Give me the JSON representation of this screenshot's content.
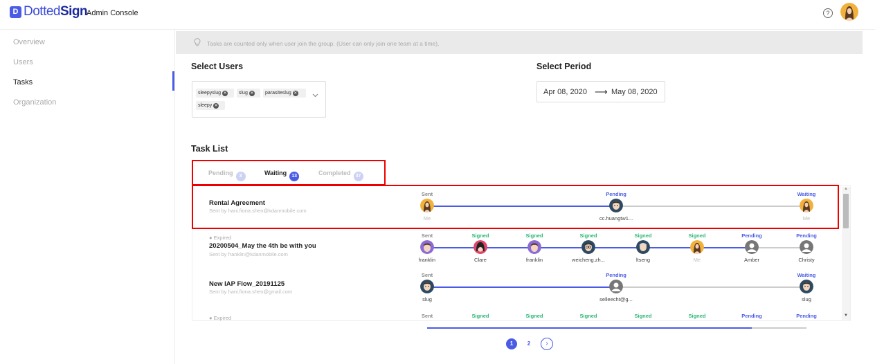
{
  "header": {
    "logo_mark": "D",
    "logo_text_a": "Dotted",
    "logo_text_b": "Sign",
    "admin_label": "Admin Console",
    "help_glyph": "?",
    "help_icon": "help-icon",
    "avatar_icon": "user-avatar-icon"
  },
  "sidebar": {
    "items": [
      {
        "label": "Overview"
      },
      {
        "label": "Users"
      },
      {
        "label": "Tasks",
        "active": true
      },
      {
        "label": "Organization"
      }
    ]
  },
  "notice": {
    "icon": "lightbulb-icon",
    "text": "Tasks are counted only when user join the group. (User can only join one team at a time)."
  },
  "select_users": {
    "title": "Select Users",
    "tags": [
      "sleepyslug",
      "slug",
      "parasiteslug",
      "sleepy"
    ],
    "remove_glyph": "✕"
  },
  "select_period": {
    "title": "Select Period",
    "start": "Apr 08, 2020",
    "arrow": "⟶",
    "end": "May 08, 2020"
  },
  "task_list": {
    "title": "Task List",
    "tabs": [
      {
        "label": "Pending",
        "count": "3"
      },
      {
        "label": "Waiting",
        "count": "13",
        "active": true
      },
      {
        "label": "Completed",
        "count": "37"
      }
    ],
    "tasks": [
      {
        "title": "Rental Agreement",
        "sender": "Sent by hani.fiona.shen@kdanmobile.com",
        "steps": [
          {
            "status": "Sent",
            "name": "Me"
          },
          {
            "status": "Pending",
            "name": "cc.huangtw1..."
          },
          {
            "status": "Waiting",
            "name": "Me"
          }
        ]
      },
      {
        "expired": "Expired",
        "title": "20200504_May the 4th be with you",
        "sender": "Sent by franklin@kdanmobile.com",
        "steps": [
          {
            "status": "Sent",
            "name": "franklin"
          },
          {
            "status": "Signed",
            "name": "Clare"
          },
          {
            "status": "Signed",
            "name": "franklin"
          },
          {
            "status": "Signed",
            "name": "weicheng.zh..."
          },
          {
            "status": "Signed",
            "name": "ltseng"
          },
          {
            "status": "Signed",
            "name": "Me"
          },
          {
            "status": "Pending",
            "name": "Amber"
          },
          {
            "status": "Pending",
            "name": "Christy"
          }
        ]
      },
      {
        "title": "New IAP Flow_20191125",
        "sender": "Sent by hani.fiona.shen@gmail.com",
        "steps": [
          {
            "status": "Sent",
            "name": "slug"
          },
          {
            "status": "Pending",
            "name": "selleecht@g..."
          },
          {
            "status": "Waiting",
            "name": "slug"
          }
        ]
      },
      {
        "expired": "Expired",
        "steps": [
          {
            "status": "Sent"
          },
          {
            "status": "Signed"
          },
          {
            "status": "Signed"
          },
          {
            "status": "Signed"
          },
          {
            "status": "Signed"
          },
          {
            "status": "Signed"
          },
          {
            "status": "Pending"
          },
          {
            "status": "Pending"
          }
        ]
      }
    ]
  },
  "pagination": {
    "pages": [
      "1",
      "2"
    ],
    "current": "1",
    "next_glyph": "›",
    "next_icon": "chevron-right-icon"
  },
  "colors": {
    "accent": "#4a5be6",
    "signed": "#2bb673",
    "highlight": "#e00000"
  }
}
